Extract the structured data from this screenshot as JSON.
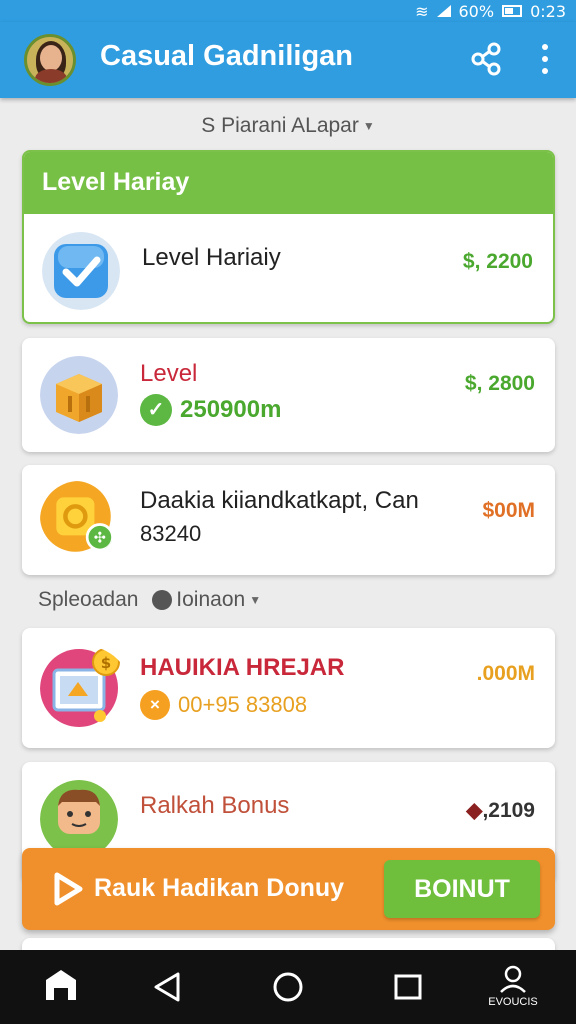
{
  "status_bar": {
    "battery": "60%",
    "time": "0:23"
  },
  "app": {
    "title": "Casual Gadniligan"
  },
  "section1": {
    "label": "S Piarani ALapar"
  },
  "featured_card": {
    "header": "Level Hariay",
    "title": "Level Hariaiy",
    "amount": "$, 2200",
    "amount_color": "#4aa82e"
  },
  "card2": {
    "title": "Level",
    "subtitle": "250900m",
    "amount": "$, 2800",
    "amount_color": "#4aa82e"
  },
  "card3": {
    "title": "Daakia kiiandkatkapt, Can",
    "subtitle": "83240",
    "amount": "$00M",
    "amount_color": "#e07025"
  },
  "section2": {
    "label": "Spleoadan",
    "label2": "Ioinaon"
  },
  "card4": {
    "title": "HAUIKIA HREJAR",
    "subtitle": "00+95 83808",
    "amount": ".000M",
    "amount_color": "#e8a020"
  },
  "card5": {
    "title": "Ralkah Bonus",
    "amount": ",2109",
    "amount_color": "#333333"
  },
  "banner": {
    "text": "Rauk Hadikan Donuy",
    "button": "BOINUT"
  },
  "nav": {
    "profile_label": "EVOUCIS"
  }
}
